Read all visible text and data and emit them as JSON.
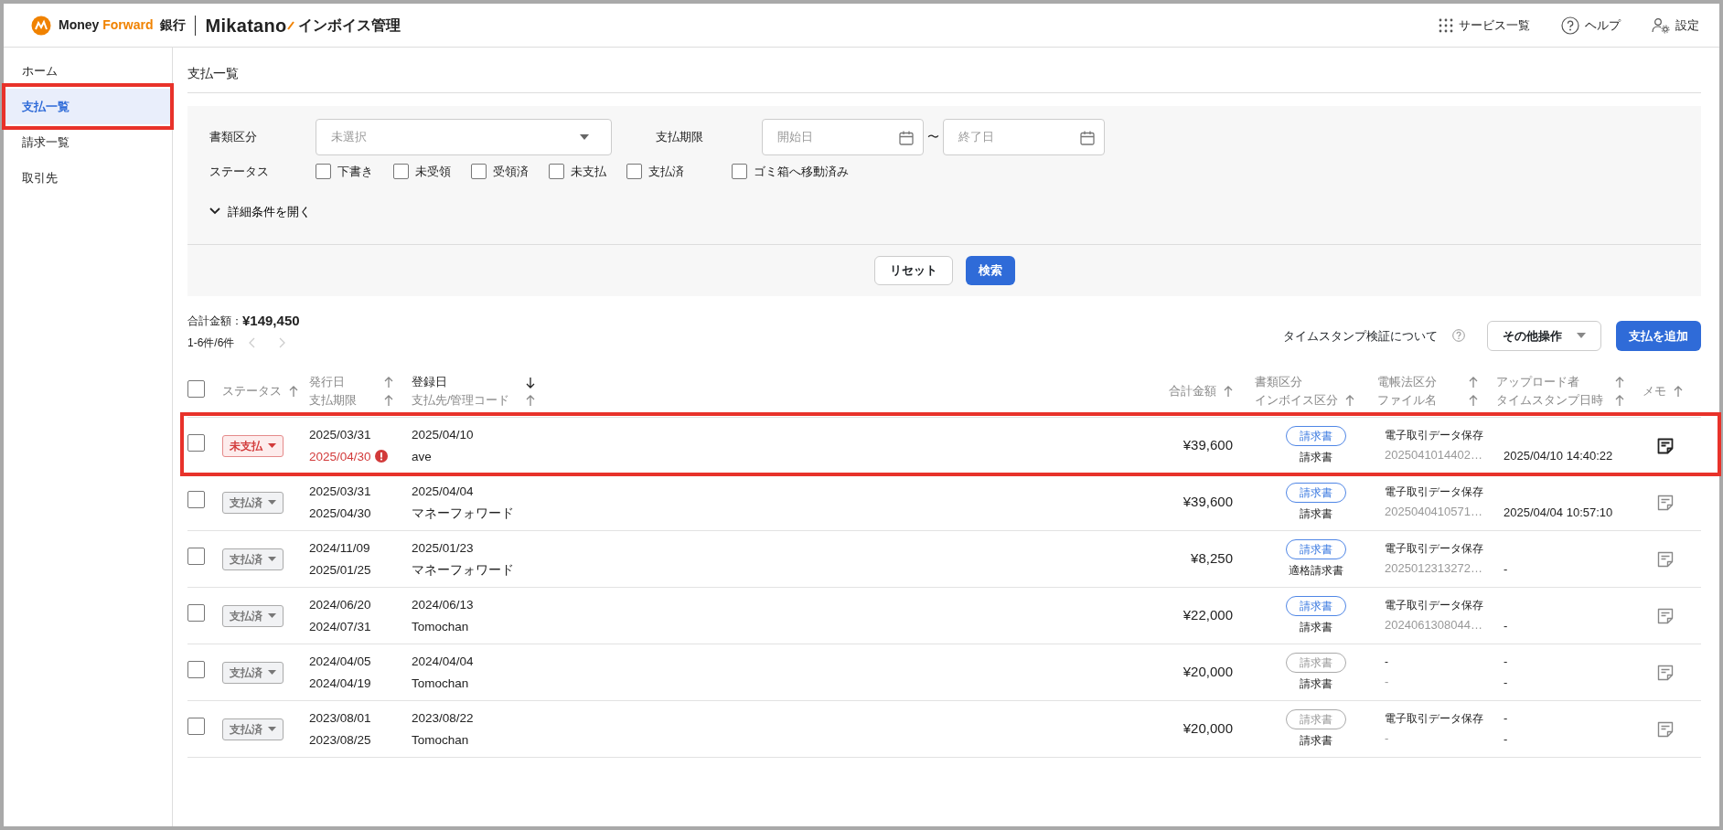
{
  "header": {
    "brand_first": "Money",
    "brand_second": "Forward",
    "brand_bank": "銀行",
    "product": "Mikatano",
    "product_suffix": "インボイス管理",
    "actions": [
      {
        "label": "サービス一覧",
        "kind": "grid"
      },
      {
        "label": "ヘルプ",
        "kind": "help"
      },
      {
        "label": "設定",
        "kind": "settings"
      }
    ]
  },
  "sidebar": {
    "items": [
      {
        "label": "ホーム",
        "selected": false,
        "highlighted": false
      },
      {
        "label": "支払一覧",
        "selected": true,
        "highlighted": true
      },
      {
        "label": "請求一覧",
        "selected": false,
        "highlighted": false
      },
      {
        "label": "取引先",
        "selected": false,
        "highlighted": false
      }
    ]
  },
  "page_title": "支払一覧",
  "filters": {
    "doc_type": {
      "label": "書類区分",
      "placeholder": "未選択"
    },
    "due": {
      "label": "支払期限",
      "start_placeholder": "開始日",
      "separator": "〜",
      "end_placeholder": "終了日"
    },
    "status": {
      "label": "ステータス",
      "options": [
        {
          "label": "下書き",
          "checked": false
        },
        {
          "label": "未受領",
          "checked": false
        },
        {
          "label": "受領済",
          "checked": false
        },
        {
          "label": "未支払",
          "checked": false
        },
        {
          "label": "支払済",
          "checked": false
        },
        {
          "label": "ゴミ箱へ移動済み",
          "checked": false
        }
      ]
    },
    "details_toggle": {
      "label": "詳細条件を開く",
      "expanded": false
    },
    "reset": "リセット",
    "search": "検索"
  },
  "summary": {
    "total_label": "合計金額：",
    "total": "¥149,450",
    "range": "1-6件/6件"
  },
  "toolbar": {
    "timestamp_link": "タイムスタンプ検証について",
    "more": "その他操作",
    "add": "支払を追加"
  },
  "table": {
    "select_all_checked": false,
    "columns": [
      {
        "lines": [
          {
            "text": "ステータス",
            "sortable": true,
            "descending": false,
            "active": false
          }
        ]
      },
      {
        "lines": [
          {
            "text": "発行日",
            "sortable": true,
            "descending": false,
            "active": false
          },
          {
            "text": "支払期限",
            "sortable": true,
            "descending": false,
            "active": false
          }
        ]
      },
      {
        "lines": [
          {
            "text": "登録日",
            "sortable": true,
            "descending": true,
            "active": true
          },
          {
            "text": "支払先/管理コード",
            "sortable": true,
            "descending": false,
            "active": false
          }
        ]
      },
      {
        "lines": [
          {
            "text": "合計金額",
            "sortable": true,
            "descending": false,
            "active": false
          }
        ]
      },
      {
        "lines": [
          {
            "text": "書類区分",
            "sortable": false,
            "active": false
          },
          {
            "text": "インボイス区分",
            "sortable": true,
            "descending": false,
            "active": false
          }
        ]
      },
      {
        "lines": [
          {
            "text": "電帳法区分",
            "sortable": true,
            "descending": false,
            "active": false
          },
          {
            "text": "ファイル名",
            "sortable": true,
            "descending": false,
            "active": false
          }
        ]
      },
      {
        "lines": [
          {
            "text": "アップロード者",
            "sortable": true,
            "descending": false,
            "active": false
          },
          {
            "text": "タイムスタンプ日時",
            "sortable": true,
            "descending": false,
            "active": false
          }
        ]
      },
      {
        "lines": [
          {
            "text": "メモ",
            "sortable": true,
            "descending": false,
            "active": false
          }
        ]
      }
    ],
    "rows": [
      {
        "checked": false,
        "highlighted": true,
        "status": {
          "label": "未支払",
          "kind": "unpaid"
        },
        "issue_date": "2025/03/31",
        "due_date": "2025/04/30",
        "overdue": true,
        "registered": "2025/04/10",
        "payee": "ave",
        "amount": "¥39,600",
        "doc_type": {
          "label": "請求書",
          "active": true
        },
        "invoice_type": "請求書",
        "denchoho": "電子取引データ保存",
        "file_name": "2025041014402…",
        "timestamp": "2025/04/10 14:40:22",
        "memo_present": true
      },
      {
        "checked": false,
        "highlighted": false,
        "status": {
          "label": "支払済",
          "kind": "paid"
        },
        "issue_date": "2025/03/31",
        "due_date": "2025/04/30",
        "overdue": false,
        "registered": "2025/04/04",
        "payee": "マネーフォワード",
        "amount": "¥39,600",
        "doc_type": {
          "label": "請求書",
          "active": true
        },
        "invoice_type": "請求書",
        "denchoho": "電子取引データ保存",
        "file_name": "2025040410571…",
        "timestamp": "2025/04/04 10:57:10",
        "memo_present": false
      },
      {
        "checked": false,
        "highlighted": false,
        "status": {
          "label": "支払済",
          "kind": "paid"
        },
        "issue_date": "2024/11/09",
        "due_date": "2025/01/25",
        "overdue": false,
        "registered": "2025/01/23",
        "payee": "マネーフォワード",
        "amount": "¥8,250",
        "doc_type": {
          "label": "請求書",
          "active": true
        },
        "invoice_type": "適格請求書",
        "denchoho": "電子取引データ保存",
        "file_name": "2025012313272…",
        "timestamp": "-",
        "memo_present": false
      },
      {
        "checked": false,
        "highlighted": false,
        "status": {
          "label": "支払済",
          "kind": "paid"
        },
        "issue_date": "2024/06/20",
        "due_date": "2024/07/31",
        "overdue": false,
        "registered": "2024/06/13",
        "payee": "Tomochan",
        "amount": "¥22,000",
        "doc_type": {
          "label": "請求書",
          "active": true
        },
        "invoice_type": "請求書",
        "denchoho": "電子取引データ保存",
        "file_name": "2024061308044…",
        "timestamp": "-",
        "memo_present": false
      },
      {
        "checked": false,
        "highlighted": false,
        "status": {
          "label": "支払済",
          "kind": "paid"
        },
        "issue_date": "2024/04/05",
        "due_date": "2024/04/19",
        "overdue": false,
        "registered": "2024/04/04",
        "payee": "Tomochan",
        "amount": "¥20,000",
        "doc_type": {
          "label": "請求書",
          "active": false
        },
        "invoice_type": "請求書",
        "denchoho": "-",
        "file_name": "-",
        "uploader": "-",
        "timestamp": "-",
        "memo_present": false
      },
      {
        "checked": false,
        "highlighted": false,
        "status": {
          "label": "支払済",
          "kind": "paid"
        },
        "issue_date": "2023/08/01",
        "due_date": "2023/08/25",
        "overdue": false,
        "registered": "2023/08/22",
        "payee": "Tomochan",
        "amount": "¥20,000",
        "doc_type": {
          "label": "請求書",
          "active": false
        },
        "invoice_type": "請求書",
        "denchoho": "電子取引データ保存",
        "file_name": "-",
        "uploader": "-",
        "timestamp": "-",
        "memo_present": false
      }
    ]
  }
}
